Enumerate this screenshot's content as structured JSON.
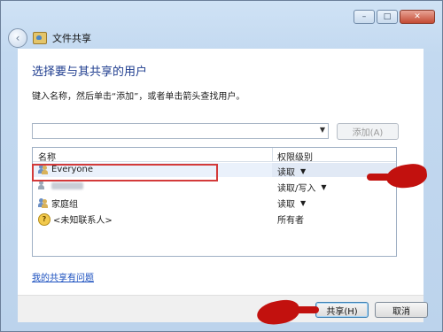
{
  "window": {
    "title": "文件共享",
    "controls": {
      "minimize": "–",
      "maximize": "□",
      "close": "✕"
    }
  },
  "header": {
    "heading": "选择要与其共享的用户",
    "instruction": "键入名称，然后单击“添加”，或者单击箭头查找用户。"
  },
  "picker": {
    "input_value": "",
    "add_label": "添加(A)"
  },
  "table": {
    "columns": {
      "name": "名称",
      "permission": "权限级别"
    },
    "rows": [
      {
        "name": "Everyone",
        "permission": "读取",
        "has_dropdown": true,
        "icon": "group-icon"
      },
      {
        "name": "",
        "permission": "读取/写入",
        "has_dropdown": true,
        "icon": "user-icon"
      },
      {
        "name": "家庭组",
        "permission": "读取",
        "has_dropdown": true,
        "icon": "homegroup-icon"
      },
      {
        "name": "<未知联系人>",
        "permission": "所有者",
        "has_dropdown": false,
        "icon": "unknown-contact-icon"
      }
    ]
  },
  "links": {
    "problem": "我的共享有问题"
  },
  "footer": {
    "share_label": "共享(H)",
    "cancel_label": "取消"
  },
  "colors": {
    "accent": "#1f3d8f",
    "highlight": "#d33a3a",
    "annotation": "#c2110e"
  }
}
